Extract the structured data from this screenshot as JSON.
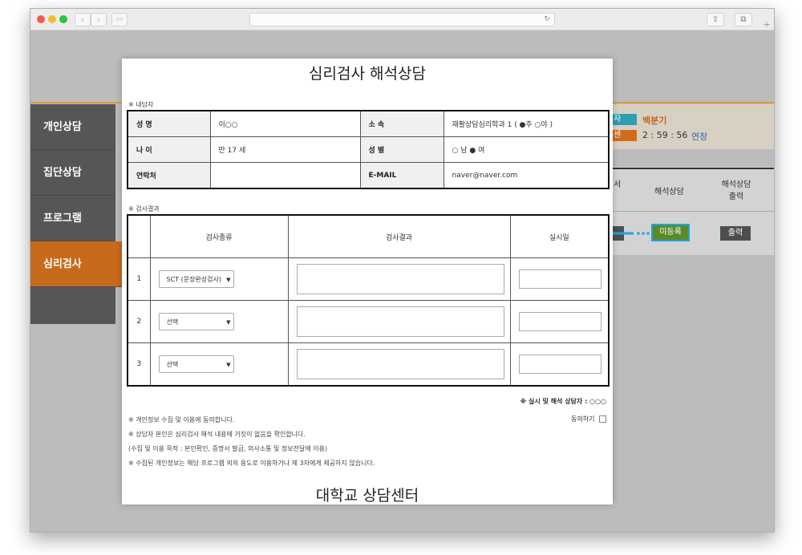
{
  "sidebar": {
    "items": [
      "개인상담",
      "집단상담",
      "프로그램",
      "심리검사"
    ]
  },
  "background": {
    "badge1": "자",
    "badge2": "센",
    "counselor_name": "백분기",
    "timer": "2 : 59 : 56",
    "extend": "연장",
    "col1_partial": "서",
    "col1_partial2": "l",
    "col2_header": "해석상담",
    "col3_header": "해석상담 출력",
    "col3_line1": "해석상담",
    "col3_line2": "출력",
    "unregistered_button": "미등록",
    "print_button": "출력"
  },
  "modal": {
    "title": "심리검사 해석상담",
    "section1": "※ 내담자",
    "info": {
      "name_label": "성 명",
      "name_value": "이○○",
      "affil_label": "소 속",
      "affil_value": "재활상담심리학과 1 ( ●주 ○야 )",
      "age_label": "나 이",
      "age_value": "만 17 세",
      "gender_label": "성 별",
      "gender_value": "○ 남   ● 여",
      "contact_label": "연락처",
      "contact_value": "",
      "email_label": "E-MAIL",
      "email_value": "naver@naver.com"
    },
    "section2": "※ 검사결과",
    "results_headers": [
      "검사종류",
      "검사결과",
      "실시일"
    ],
    "rows": [
      {
        "num": "1",
        "type": "SCT (문장완성검사)"
      },
      {
        "num": "2",
        "type": "선택"
      },
      {
        "num": "3",
        "type": "선택"
      }
    ],
    "counselor_line": "※ 실시 및 해석 상담자 : ○○○",
    "agree_label": "동의하기",
    "notes": [
      "※ 개인정보 수집 및 이용에 동의합니다.",
      "※ 상담자 본인은 심리검사 해석 내용에 거짓이 없음을 확인합니다.",
      "(수집 및 이용 목적 : 본인확인, 증명서 발급, 의사소통 및 정보전달에 이용)",
      "※ 수집된 개인정보는 해당 프로그램 외의 용도로 이용하거나 제 3자에게 제공하지 않습니다."
    ],
    "center_name": "대학교  상담센터"
  }
}
